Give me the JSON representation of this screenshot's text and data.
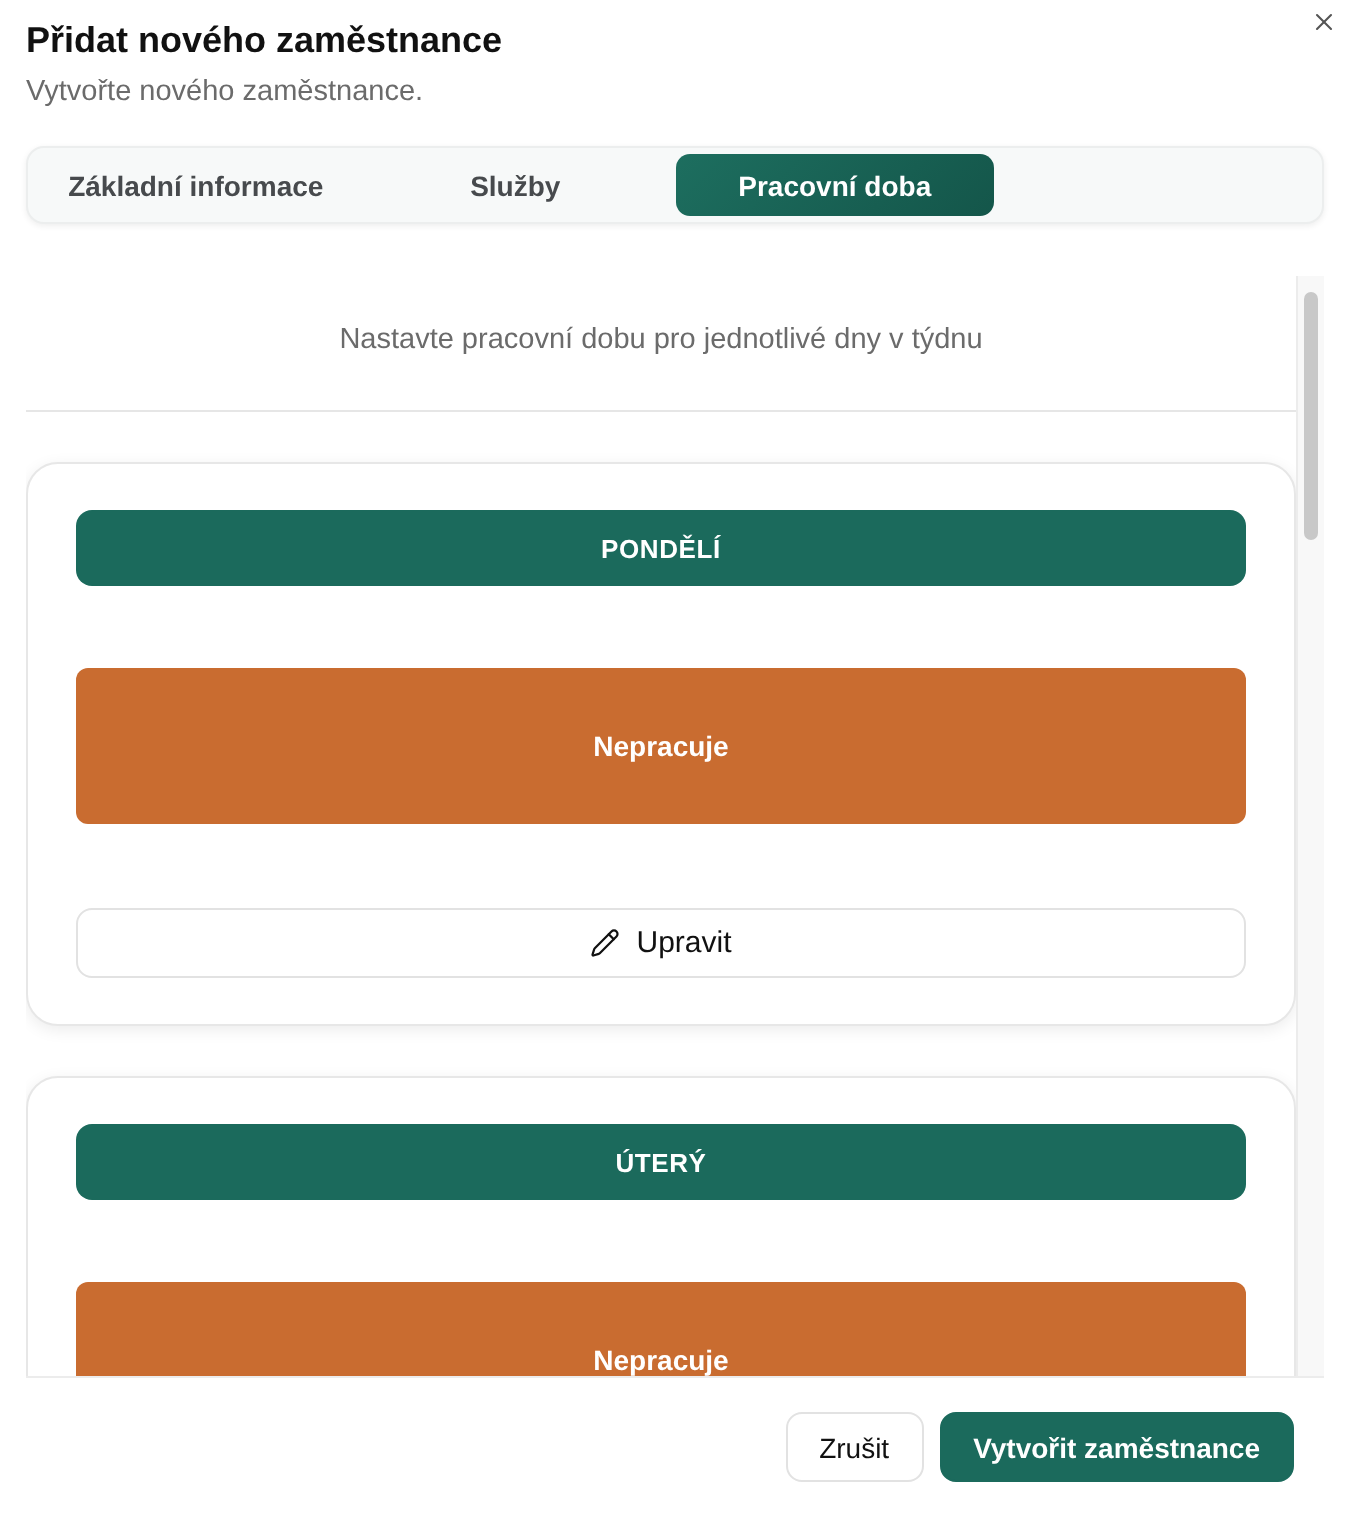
{
  "dialog": {
    "title": "Přidat nového zaměstnance",
    "subtitle": "Vytvořte nového zaměstnance."
  },
  "tabs": [
    {
      "label": "Základní informace",
      "selected": false
    },
    {
      "label": "Služby",
      "selected": false
    },
    {
      "label": "Pracovní doba",
      "selected": true
    }
  ],
  "hint": "Nastavte pracovní dobu pro jednotlivé dny v týdnu",
  "days": [
    {
      "name": "PONDĚLÍ",
      "status": "Nepracuje",
      "working": false,
      "edit_label": "Upravit"
    },
    {
      "name": "ÚTERÝ",
      "status": "Nepracuje",
      "working": false
    }
  ],
  "buttons": [
    {
      "label": "Zrušit",
      "kind": "secondary"
    },
    {
      "label": "Vytvořit zaměstnance",
      "kind": "primary"
    }
  ]
}
